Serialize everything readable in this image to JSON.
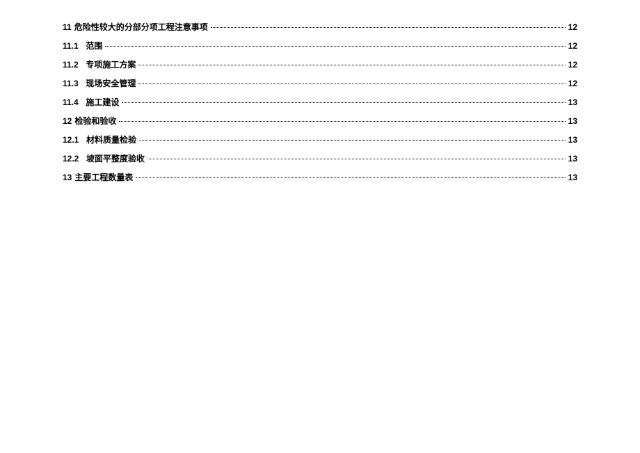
{
  "toc": [
    {
      "number": "11",
      "title": "危险性较大的分部分项工程注意事项",
      "page": "12",
      "indent": 0
    },
    {
      "number": "11.1",
      "title": "范围",
      "page": "12",
      "indent": 1
    },
    {
      "number": "11.2",
      "title": "专项施工方案",
      "page": "12",
      "indent": 1
    },
    {
      "number": "11.3",
      "title": "现场安全管理",
      "page": "12",
      "indent": 1
    },
    {
      "number": "11.4",
      "title": "施工建设",
      "page": "13",
      "indent": 1
    },
    {
      "number": "12",
      "title": "检验和验收",
      "page": "13",
      "indent": 0
    },
    {
      "number": "12.1",
      "title": "材料质量检验",
      "page": "13",
      "indent": 1
    },
    {
      "number": "12.2",
      "title": "坡面平整度验收",
      "page": "13",
      "indent": 1
    },
    {
      "number": "13",
      "title": "主要工程数量表",
      "page": "13",
      "indent": 0
    }
  ]
}
